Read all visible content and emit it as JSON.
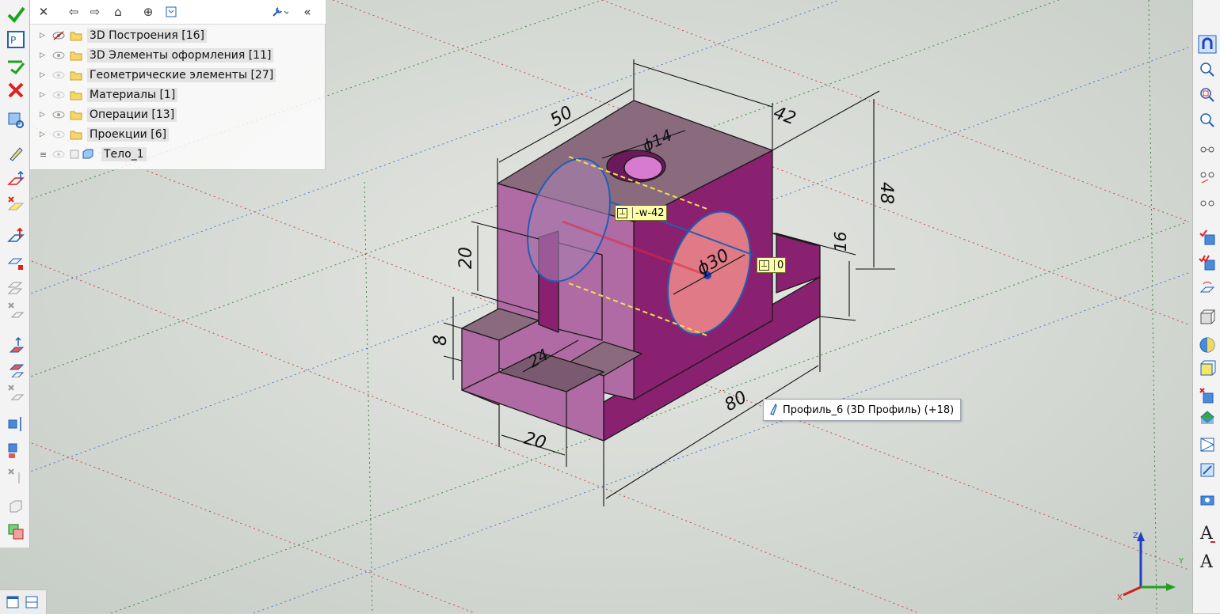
{
  "tree": {
    "items": [
      {
        "label": "3D Построения [16]",
        "icon": "hidden-eye-icon"
      },
      {
        "label": "3D Элементы оформления [11]",
        "icon": "eye-icon"
      },
      {
        "label": "Геометрические элементы [27]",
        "icon": "eye-icon"
      },
      {
        "label": "Материалы [1]",
        "icon": "eye-icon"
      },
      {
        "label": "Операции [13]",
        "icon": "eye-icon"
      },
      {
        "label": "Проекции [6]",
        "icon": "eye-icon"
      },
      {
        "label": "Тело_1",
        "icon": "body-icon"
      }
    ]
  },
  "tree_toolbar": {
    "icons": [
      "close-icon",
      "back-icon",
      "forward-icon",
      "home-icon",
      "target-icon",
      "expand-icon",
      "wrench-icon",
      "collapse-icon"
    ]
  },
  "viewport": {
    "dimensions": {
      "d50": "50",
      "d42": "42",
      "d48": "48",
      "d14": "ϕ14",
      "d30": "ϕ30",
      "d20_left": "20",
      "d16": "16",
      "d8": "8",
      "d24": "24",
      "d20_bottom": "20",
      "d80": "80"
    },
    "param_w": {
      "value": "-w-42"
    },
    "param_zero": {
      "value": "0"
    },
    "hover_tooltip": "Профиль_6 (3D Профиль) (+18)",
    "axis_labels": {
      "z": "Z",
      "x": "X",
      "y": "Y"
    }
  },
  "colors": {
    "body_top": "#8a6b7e",
    "body_front": "#b06aa4",
    "body_side": "#8a2070",
    "accent_blue": "#1f5fb4",
    "selection_red": "#e0283a"
  }
}
